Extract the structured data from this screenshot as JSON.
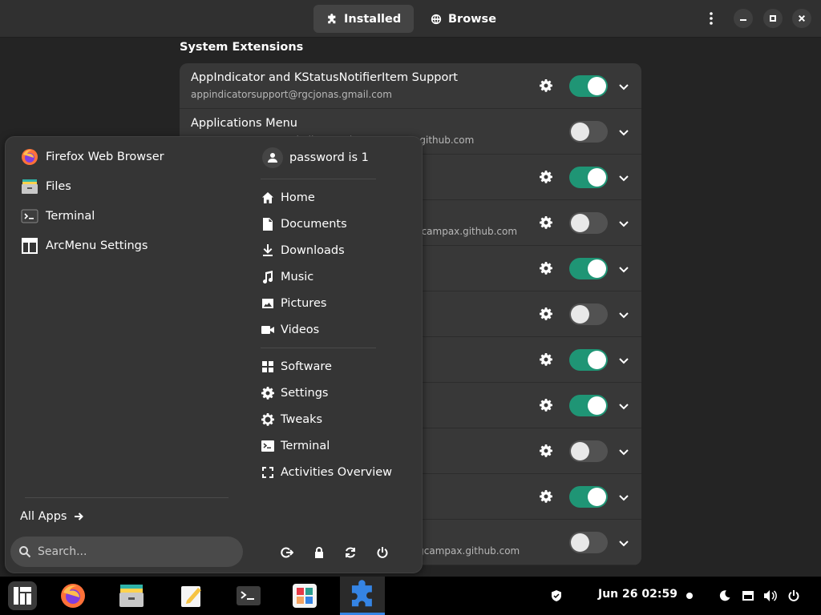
{
  "header": {
    "tabs": [
      {
        "label": "Installed",
        "icon": "puzzle-icon",
        "active": true
      },
      {
        "label": "Browse",
        "icon": "globe-icon",
        "active": false
      }
    ]
  },
  "section_title": "System Extensions",
  "extensions": [
    {
      "name": "AppIndicator and KStatusNotifierItem Support",
      "email": "appindicatorsupport@rgcjonas.gmail.com",
      "has_settings": true,
      "enabled": true
    },
    {
      "name": "Applications Menu",
      "email": "apps-menu@gnome-shell-extensions.gcampax.github.com",
      "has_settings": false,
      "enabled": false
    },
    {
      "name": "",
      "email": "",
      "has_settings": true,
      "enabled": true
    },
    {
      "name": "",
      "email": "auto-move-windows@gnome-shell-extensions.gcampax.github.com",
      "has_settings": true,
      "enabled": false
    },
    {
      "name": "",
      "email": "",
      "has_settings": true,
      "enabled": true
    },
    {
      "name": "",
      "email": "",
      "has_settings": true,
      "enabled": false
    },
    {
      "name": "",
      "email": "",
      "has_settings": true,
      "enabled": true
    },
    {
      "name": "",
      "email": "",
      "has_settings": true,
      "enabled": true
    },
    {
      "name": "",
      "email": "",
      "has_settings": true,
      "enabled": false
    },
    {
      "name": "",
      "email": "",
      "has_settings": true,
      "enabled": true
    },
    {
      "name": "",
      "email": "launch-new-instance@gnome-shell-extensions.gcampax.github.com",
      "has_settings": false,
      "enabled": false
    }
  ],
  "arcmenu": {
    "apps": [
      {
        "label": "Firefox Web Browser",
        "icon": "firefox-icon"
      },
      {
        "label": "Files",
        "icon": "files-icon"
      },
      {
        "label": "Terminal",
        "icon": "terminal-icon"
      },
      {
        "label": "ArcMenu Settings",
        "icon": "arcmenu-settings-icon"
      }
    ],
    "all_apps_label": "All Apps",
    "search_placeholder": "Search...",
    "user_label": "password is 1",
    "places": [
      {
        "label": "Home",
        "icon": "home-icon"
      },
      {
        "label": "Documents",
        "icon": "document-icon"
      },
      {
        "label": "Downloads",
        "icon": "download-icon"
      },
      {
        "label": "Music",
        "icon": "music-icon"
      },
      {
        "label": "Pictures",
        "icon": "picture-icon"
      },
      {
        "label": "Videos",
        "icon": "video-icon"
      }
    ],
    "shortcuts": [
      {
        "label": "Software",
        "icon": "software-icon"
      },
      {
        "label": "Settings",
        "icon": "gear-icon"
      },
      {
        "label": "Tweaks",
        "icon": "tweaks-icon"
      },
      {
        "label": "Terminal",
        "icon": "terminal-icon"
      },
      {
        "label": "Activities Overview",
        "icon": "activities-icon"
      }
    ],
    "power_buttons": [
      "logout-icon",
      "lock-icon",
      "restart-icon",
      "power-icon"
    ]
  },
  "taskbar": {
    "apps": [
      "manjaro-menu-icon",
      "firefox-icon",
      "files-icon",
      "text-editor-icon",
      "terminal-icon",
      "software-icon",
      "extensions-icon"
    ],
    "active_app": "extensions-icon",
    "clock": "Jun 26  02:59",
    "tray": [
      "shield-icon",
      "night-light-icon",
      "keyboard-icon",
      "volume-icon",
      "power-icon"
    ]
  },
  "colors": {
    "accent": "#1f9575",
    "panel": "#353535",
    "row": "#383838",
    "taskbar": "#000000"
  }
}
